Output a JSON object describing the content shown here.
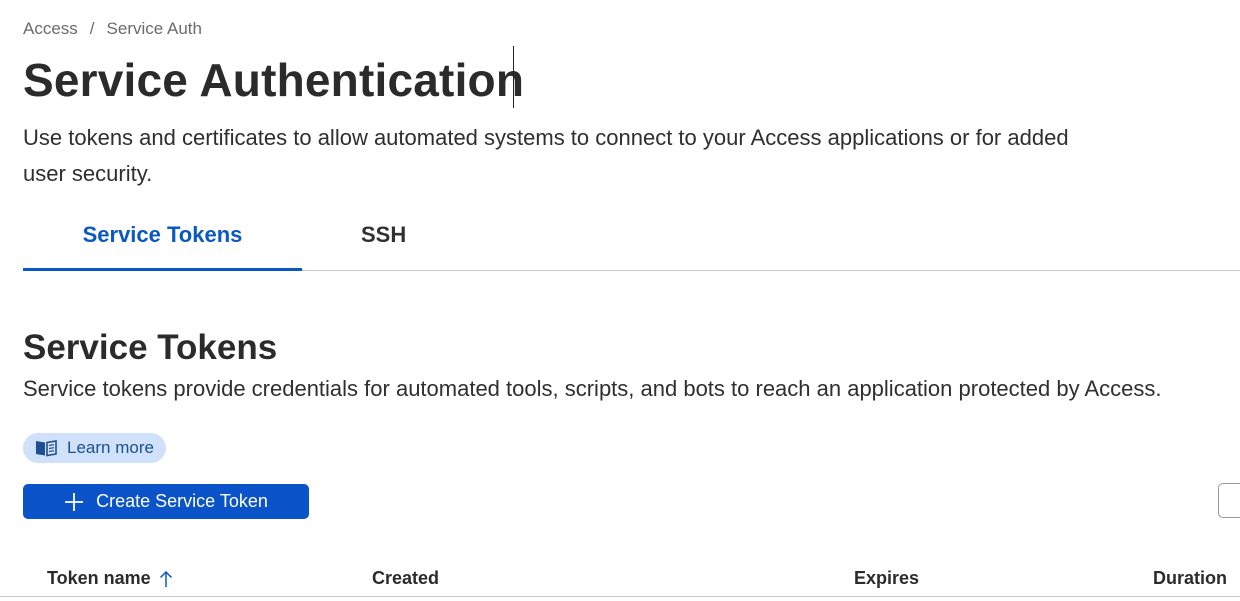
{
  "breadcrumb": {
    "items": [
      "Access",
      "Service Auth"
    ],
    "separator": "/"
  },
  "page": {
    "title": "Service Authentication",
    "description": "Use tokens and certificates to allow automated systems to connect to your Access applications or for added user security."
  },
  "tabs": [
    {
      "label": "Service Tokens",
      "active": true
    },
    {
      "label": "SSH",
      "active": false
    }
  ],
  "section": {
    "title": "Service Tokens",
    "description": "Service tokens provide credentials for automated tools, scripts, and bots to reach an application protected by Access.",
    "learn_more_label": "Learn more",
    "learn_more_icon": "book-icon",
    "create_button_label": "Create Service Token",
    "create_button_icon": "plus-icon"
  },
  "table": {
    "columns": [
      {
        "label": "Token name",
        "sorted": "ascending",
        "sort_icon": "arrow-up-icon"
      },
      {
        "label": "Created"
      },
      {
        "label": "Expires"
      },
      {
        "label": "Duration"
      }
    ]
  },
  "colors": {
    "accent": "#0a58c2",
    "primary_button": "#0a53c9",
    "learn_more_bg": "#cfe1fb",
    "learn_more_text": "#1d4f91"
  }
}
